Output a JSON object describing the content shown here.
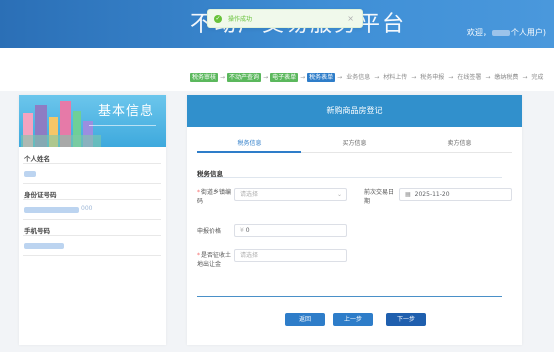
{
  "header": {
    "title": "不动产交易服务平台",
    "welcome_prefix": "欢迎，",
    "welcome_suffix": "个人用户)"
  },
  "toast": {
    "message": "操作成功",
    "status_color": "#67c23a"
  },
  "steps": [
    {
      "label": "税务审核",
      "state": "done"
    },
    {
      "label": "不动产查询",
      "state": "done"
    },
    {
      "label": "电子表单",
      "state": "done"
    },
    {
      "label": "税务表单",
      "state": "active"
    },
    {
      "label": "业务信息",
      "state": "pending"
    },
    {
      "label": "材料上传",
      "state": "pending"
    },
    {
      "label": "税务申报",
      "state": "pending"
    },
    {
      "label": "在线签署",
      "state": "pending"
    },
    {
      "label": "缴纳税费",
      "state": "pending"
    },
    {
      "label": "完成",
      "state": "pending"
    }
  ],
  "left": {
    "banner_title": "基本信息",
    "name_label": "个人姓名",
    "id_label": "身份证号码",
    "id_partial": "000",
    "phone_label": "手机号码"
  },
  "main": {
    "title": "新购商品房登记",
    "tabs": [
      "税务信息",
      "买方信息",
      "卖方信息"
    ],
    "active_tab": 0,
    "section_title": "税务信息",
    "fields": {
      "street_label": "街道乡镇编码",
      "street_placeholder": "请选择",
      "prev_date_label": "前次交易日期",
      "prev_date_value": "2025-11-20",
      "price_label": "申报价格",
      "price_value": "0",
      "price_prefix": "¥",
      "land_label": "是否征收土地出让金",
      "land_placeholder": "请选择"
    },
    "buttons": {
      "back": "返回",
      "prev": "上一步",
      "next": "下一步"
    }
  },
  "colors": {
    "header_blue": "#2b6fb6",
    "step_done": "#5bb85d",
    "step_active": "#2e7dc9",
    "card_head": "#3190cc"
  }
}
